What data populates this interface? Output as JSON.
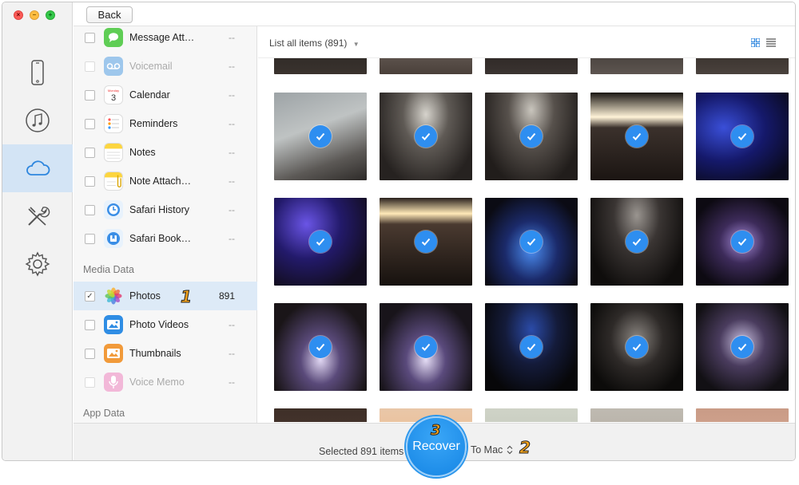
{
  "window": {
    "back_label": "Back"
  },
  "rail": {
    "items": [
      {
        "icon": "iphone-icon",
        "active": false
      },
      {
        "icon": "itunes-icon",
        "active": false
      },
      {
        "icon": "icloud-icon",
        "active": true
      },
      {
        "icon": "tools-icon",
        "active": false
      },
      {
        "icon": "gear-icon",
        "active": false
      }
    ]
  },
  "categories": {
    "rows": [
      {
        "label": "Message Att…",
        "count": "--",
        "icon": "message-attachment-icon",
        "disabled": false
      },
      {
        "label": "Voicemail",
        "count": "--",
        "icon": "voicemail-icon",
        "disabled": true
      },
      {
        "label": "Calendar",
        "count": "--",
        "icon": "calendar-icon",
        "disabled": false
      },
      {
        "label": "Reminders",
        "count": "--",
        "icon": "reminders-icon",
        "disabled": false
      },
      {
        "label": "Notes",
        "count": "--",
        "icon": "notes-icon",
        "disabled": false
      },
      {
        "label": "Note Attach…",
        "count": "--",
        "icon": "note-attachment-icon",
        "disabled": false
      },
      {
        "label": "Safari History",
        "count": "--",
        "icon": "safari-history-icon",
        "disabled": false
      },
      {
        "label": "Safari Book…",
        "count": "--",
        "icon": "safari-bookmark-icon",
        "disabled": false
      }
    ],
    "media_heading": "Media Data",
    "media_rows": [
      {
        "label": "Photos",
        "count": "891",
        "icon": "photos-icon",
        "checked": true,
        "disabled": false
      },
      {
        "label": "Photo Videos",
        "count": "--",
        "icon": "photo-videos-icon",
        "checked": false,
        "disabled": false
      },
      {
        "label": "Thumbnails",
        "count": "--",
        "icon": "thumbnails-icon",
        "checked": false,
        "disabled": false
      },
      {
        "label": "Voice Memo",
        "count": "--",
        "icon": "voice-memo-icon",
        "checked": false,
        "disabled": true
      }
    ],
    "app_heading": "App Data"
  },
  "main": {
    "list_filter": "List all items (891)",
    "view_modes": [
      "grid-view-icon",
      "list-view-icon"
    ]
  },
  "bottom": {
    "selected_text": "Selected 891 items",
    "recover_label": "Recover",
    "destination": "To Mac"
  },
  "step_badges": {
    "one": "1",
    "two": "2",
    "three": "3"
  },
  "colors": {
    "accent": "#2e8ef0",
    "selected_row": "#ddeaf7",
    "active_rail": "#d3e4f5",
    "badge": "#f4a21b"
  }
}
